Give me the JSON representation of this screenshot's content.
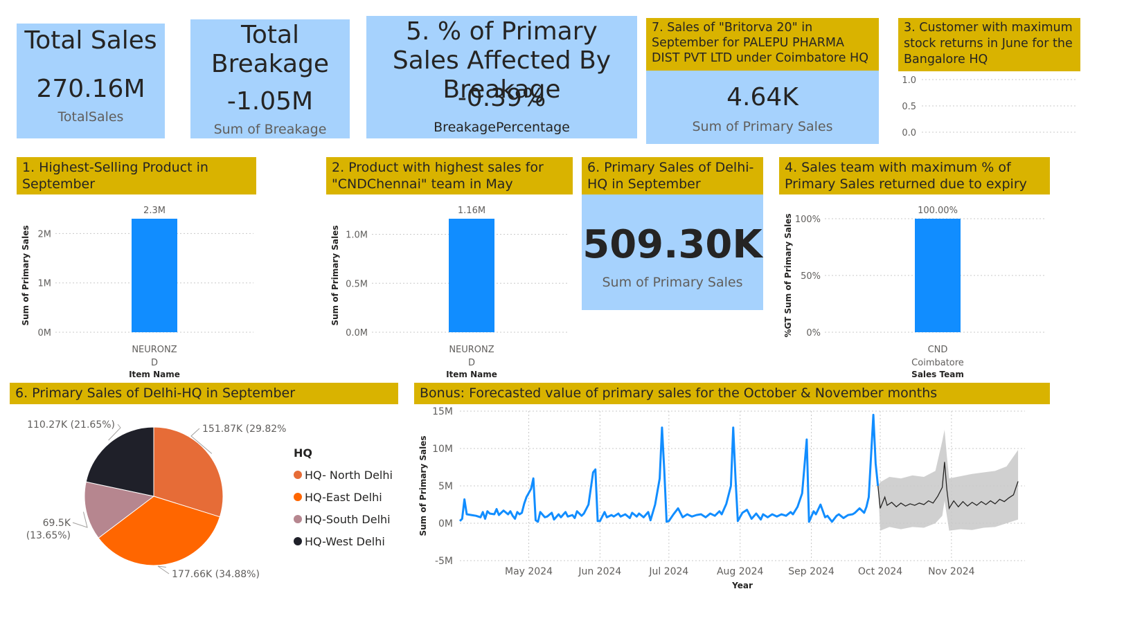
{
  "cards": {
    "total_sales": {
      "title": "Total Sales",
      "value": "270.16M",
      "label": "TotalSales"
    },
    "total_breakage": {
      "title": "Total Breakage",
      "value": "-1.05M",
      "label": "Sum of Breakage"
    },
    "breakage_pct": {
      "title": "5. % of Primary Sales Affected By Breakage",
      "value": "-0.39%",
      "label": "BreakagePercentage"
    },
    "britorva": {
      "title": "7. Sales of \"Britorva 20\" in September for PALEPU PHARMA DIST PVT LTD under Coimbatore HQ",
      "value": "4.64K",
      "label": "Sum of Primary Sales"
    },
    "delhi_sept": {
      "title": "6. Primary Sales of Delhi-HQ in September",
      "value": "509.30K",
      "label": "Sum of Primary Sales"
    }
  },
  "headers": {
    "customer_returns": "3. Customer with maximum stock returns in June for the Bangalore HQ",
    "highest_product": "1. Highest-Selling Product in September",
    "cnd_chennai": "2. Product with highest sales for \"CNDChennai\" team in May",
    "sales_team_expiry": "4. Sales team with maximum % of Primary Sales returned due to expiry",
    "delhi_pie": "6. Primary Sales of Delhi-HQ in September",
    "forecast": "Bonus: Forecasted value of primary sales for the October & November months"
  },
  "chart_data": [
    {
      "id": "customer_returns",
      "type": "bar",
      "categories": [],
      "values": [],
      "yticks": [
        "1.0",
        "0.5",
        "0.0"
      ],
      "ylim": [
        0,
        1
      ]
    },
    {
      "id": "highest_product",
      "type": "bar",
      "categories": [
        "NEURONZ D"
      ],
      "category_lines": [
        "NEURONZ",
        "D"
      ],
      "values": [
        2300000
      ],
      "data_labels": [
        "2.3M"
      ],
      "xlabel": "Item Name",
      "ylabel": "Sum of Primary Sales",
      "yticks": [
        "2M",
        "1M",
        "0M"
      ],
      "ylim": [
        0,
        2300000
      ],
      "color": "#118dff"
    },
    {
      "id": "cnd_chennai",
      "type": "bar",
      "categories": [
        "NEURONZ D"
      ],
      "category_lines": [
        "NEURONZ",
        "D"
      ],
      "values": [
        1160000
      ],
      "data_labels": [
        "1.16M"
      ],
      "xlabel": "Item Name",
      "ylabel": "Sum of Primary Sales",
      "yticks": [
        "1.0M",
        "0.5M",
        "0.0M"
      ],
      "ylim": [
        0,
        1160000
      ],
      "color": "#118dff"
    },
    {
      "id": "sales_team_expiry",
      "type": "bar",
      "categories": [
        "CND Coimbatore"
      ],
      "category_lines": [
        "CND",
        "Coimbatore"
      ],
      "values": [
        100
      ],
      "data_labels": [
        "100.00%"
      ],
      "xlabel": "Sales Team",
      "ylabel": "%GT Sum of Primary Sales",
      "yticks": [
        "100%",
        "50%",
        "0%"
      ],
      "ylim": [
        0,
        100
      ],
      "color": "#118dff"
    },
    {
      "id": "delhi_pie",
      "type": "pie",
      "legend_title": "HQ",
      "slices": [
        {
          "name": "HQ- North Delhi",
          "value": 151870,
          "label": "151.87K (29.82%)",
          "color": "#e66c37"
        },
        {
          "name": "HQ-East Delhi",
          "value": 177660,
          "label": "177.66K (34.88%)",
          "color": "#ff6600"
        },
        {
          "name": "HQ-South Delhi",
          "value": 69500,
          "label": "69.5K (13.65%)",
          "color": "#b6868f"
        },
        {
          "name": "HQ-West Delhi",
          "value": 110270,
          "label": "110.27K (21.65%)",
          "color": "#1f2029"
        }
      ]
    },
    {
      "id": "forecast",
      "type": "line",
      "xlabel": "Year",
      "ylabel": "Sum of Primary Sales",
      "x_start": "2024-04-01",
      "x_end": "2024-12-03",
      "x_ticks": [
        "May 2024",
        "Jun 2024",
        "Jul 2024",
        "Aug 2024",
        "Sep 2024",
        "Oct 2024",
        "Nov 2024"
      ],
      "x_tick_dates": [
        "2024-05-01",
        "2024-06-01",
        "2024-07-01",
        "2024-08-01",
        "2024-09-01",
        "2024-10-01",
        "2024-11-01"
      ],
      "yticks": [
        "15M",
        "10M",
        "5M",
        "0M",
        "-5M"
      ],
      "ylim": [
        -5,
        15
      ],
      "y_unit": "M",
      "actual": [
        [
          "2024-04-01",
          0.3
        ],
        [
          "2024-04-02",
          0.6
        ],
        [
          "2024-04-03",
          3.2
        ],
        [
          "2024-04-04",
          1.2
        ],
        [
          "2024-04-06",
          1.1
        ],
        [
          "2024-04-08",
          1.0
        ],
        [
          "2024-04-10",
          0.8
        ],
        [
          "2024-04-11",
          1.5
        ],
        [
          "2024-04-12",
          0.6
        ],
        [
          "2024-04-13",
          1.6
        ],
        [
          "2024-04-14",
          1.3
        ],
        [
          "2024-04-16",
          1.2
        ],
        [
          "2024-04-17",
          1.9
        ],
        [
          "2024-04-18",
          1.1
        ],
        [
          "2024-04-19",
          1.4
        ],
        [
          "2024-04-20",
          1.7
        ],
        [
          "2024-04-22",
          1.2
        ],
        [
          "2024-04-23",
          1.6
        ],
        [
          "2024-04-24",
          1.0
        ],
        [
          "2024-04-25",
          0.6
        ],
        [
          "2024-04-26",
          1.5
        ],
        [
          "2024-04-27",
          1.2
        ],
        [
          "2024-04-28",
          1.4
        ],
        [
          "2024-04-29",
          2.6
        ],
        [
          "2024-04-30",
          3.5
        ],
        [
          "2024-05-02",
          4.6
        ],
        [
          "2024-05-03",
          6.0
        ],
        [
          "2024-05-04",
          0.4
        ],
        [
          "2024-05-05",
          0.2
        ],
        [
          "2024-05-06",
          1.5
        ],
        [
          "2024-05-08",
          0.8
        ],
        [
          "2024-05-09",
          0.9
        ],
        [
          "2024-05-11",
          1.4
        ],
        [
          "2024-05-12",
          0.5
        ],
        [
          "2024-05-14",
          1.2
        ],
        [
          "2024-05-15",
          0.8
        ],
        [
          "2024-05-17",
          1.5
        ],
        [
          "2024-05-18",
          0.9
        ],
        [
          "2024-05-20",
          1.1
        ],
        [
          "2024-05-21",
          0.7
        ],
        [
          "2024-05-22",
          1.6
        ],
        [
          "2024-05-24",
          1.0
        ],
        [
          "2024-05-25",
          1.3
        ],
        [
          "2024-05-27",
          2.5
        ],
        [
          "2024-05-29",
          6.8
        ],
        [
          "2024-05-30",
          7.2
        ],
        [
          "2024-05-31",
          0.3
        ],
        [
          "2024-06-01",
          0.3
        ],
        [
          "2024-06-03",
          1.5
        ],
        [
          "2024-06-04",
          0.8
        ],
        [
          "2024-06-06",
          1.1
        ],
        [
          "2024-06-07",
          0.9
        ],
        [
          "2024-06-09",
          1.3
        ],
        [
          "2024-06-10",
          0.9
        ],
        [
          "2024-06-12",
          1.2
        ],
        [
          "2024-06-14",
          0.7
        ],
        [
          "2024-06-15",
          1.4
        ],
        [
          "2024-06-17",
          0.9
        ],
        [
          "2024-06-18",
          1.3
        ],
        [
          "2024-06-20",
          0.8
        ],
        [
          "2024-06-22",
          1.5
        ],
        [
          "2024-06-23",
          0.4
        ],
        [
          "2024-06-25",
          2.5
        ],
        [
          "2024-06-27",
          6.0
        ],
        [
          "2024-06-28",
          12.8
        ],
        [
          "2024-06-29",
          7.0
        ],
        [
          "2024-06-30",
          0.2
        ],
        [
          "2024-07-01",
          0.3
        ],
        [
          "2024-07-03",
          1.2
        ],
        [
          "2024-07-05",
          2.0
        ],
        [
          "2024-07-07",
          0.8
        ],
        [
          "2024-07-09",
          1.2
        ],
        [
          "2024-07-11",
          0.9
        ],
        [
          "2024-07-13",
          1.1
        ],
        [
          "2024-07-15",
          1.2
        ],
        [
          "2024-07-17",
          0.8
        ],
        [
          "2024-07-19",
          1.3
        ],
        [
          "2024-07-21",
          1.0
        ],
        [
          "2024-07-23",
          1.6
        ],
        [
          "2024-07-24",
          1.2
        ],
        [
          "2024-07-26",
          2.6
        ],
        [
          "2024-07-28",
          5.0
        ],
        [
          "2024-07-29",
          12.8
        ],
        [
          "2024-07-30",
          6.0
        ],
        [
          "2024-07-31",
          0.3
        ],
        [
          "2024-08-02",
          1.4
        ],
        [
          "2024-08-04",
          1.8
        ],
        [
          "2024-08-06",
          0.6
        ],
        [
          "2024-08-08",
          1.3
        ],
        [
          "2024-08-10",
          0.5
        ],
        [
          "2024-08-11",
          1.2
        ],
        [
          "2024-08-13",
          0.8
        ],
        [
          "2024-08-15",
          1.2
        ],
        [
          "2024-08-17",
          0.9
        ],
        [
          "2024-08-19",
          1.2
        ],
        [
          "2024-08-21",
          1.0
        ],
        [
          "2024-08-23",
          1.5
        ],
        [
          "2024-08-24",
          1.2
        ],
        [
          "2024-08-26",
          2.2
        ],
        [
          "2024-08-28",
          4.0
        ],
        [
          "2024-08-30",
          11.2
        ],
        [
          "2024-08-31",
          0.2
        ],
        [
          "2024-09-02",
          1.6
        ],
        [
          "2024-09-03",
          1.2
        ],
        [
          "2024-09-05",
          2.5
        ],
        [
          "2024-09-07",
          0.8
        ],
        [
          "2024-09-08",
          1.0
        ],
        [
          "2024-09-10",
          0.2
        ],
        [
          "2024-09-12",
          1.0
        ],
        [
          "2024-09-13",
          1.2
        ],
        [
          "2024-09-15",
          0.7
        ],
        [
          "2024-09-17",
          1.1
        ],
        [
          "2024-09-19",
          1.2
        ],
        [
          "2024-09-20",
          1.4
        ],
        [
          "2024-09-22",
          2.0
        ],
        [
          "2024-09-24",
          1.4
        ],
        [
          "2024-09-25",
          2.2
        ],
        [
          "2024-09-26",
          3.5
        ],
        [
          "2024-09-28",
          14.5
        ],
        [
          "2024-09-29",
          8.0
        ],
        [
          "2024-09-30",
          5.0
        ]
      ],
      "forecast": [
        [
          "2024-09-30",
          5.0
        ],
        [
          "2024-10-01",
          2.0
        ],
        [
          "2024-10-03",
          3.5
        ],
        [
          "2024-10-04",
          2.4
        ],
        [
          "2024-10-06",
          2.8
        ],
        [
          "2024-10-08",
          2.2
        ],
        [
          "2024-10-10",
          2.7
        ],
        [
          "2024-10-12",
          2.3
        ],
        [
          "2024-10-14",
          2.6
        ],
        [
          "2024-10-16",
          2.4
        ],
        [
          "2024-10-18",
          2.7
        ],
        [
          "2024-10-20",
          2.5
        ],
        [
          "2024-10-22",
          3.0
        ],
        [
          "2024-10-24",
          2.7
        ],
        [
          "2024-10-26",
          3.6
        ],
        [
          "2024-10-28",
          4.8
        ],
        [
          "2024-10-29",
          8.2
        ],
        [
          "2024-10-30",
          4.5
        ],
        [
          "2024-10-31",
          2.0
        ],
        [
          "2024-11-02",
          3.0
        ],
        [
          "2024-11-04",
          2.2
        ],
        [
          "2024-11-06",
          2.9
        ],
        [
          "2024-11-08",
          2.3
        ],
        [
          "2024-11-10",
          2.8
        ],
        [
          "2024-11-12",
          2.4
        ],
        [
          "2024-11-14",
          2.9
        ],
        [
          "2024-11-16",
          2.5
        ],
        [
          "2024-11-18",
          3.0
        ],
        [
          "2024-11-20",
          2.6
        ],
        [
          "2024-11-22",
          3.2
        ],
        [
          "2024-11-24",
          2.9
        ],
        [
          "2024-11-26",
          3.4
        ],
        [
          "2024-11-28",
          3.8
        ],
        [
          "2024-11-30",
          5.6
        ]
      ],
      "band": [
        [
          "2024-09-30",
          5.0,
          5.0
        ],
        [
          "2024-10-01",
          -1.0,
          5.5
        ],
        [
          "2024-10-05",
          -0.5,
          6.2
        ],
        [
          "2024-10-10",
          -0.8,
          6.0
        ],
        [
          "2024-10-15",
          -0.5,
          6.4
        ],
        [
          "2024-10-20",
          -0.6,
          6.2
        ],
        [
          "2024-10-25",
          0.0,
          7.0
        ],
        [
          "2024-10-28",
          1.0,
          11.0
        ],
        [
          "2024-10-29",
          3.0,
          12.5
        ],
        [
          "2024-10-30",
          1.0,
          9.0
        ],
        [
          "2024-10-31",
          -1.0,
          6.0
        ],
        [
          "2024-11-05",
          -0.8,
          6.3
        ],
        [
          "2024-11-10",
          -0.9,
          6.6
        ],
        [
          "2024-11-15",
          -0.6,
          6.8
        ],
        [
          "2024-11-20",
          -0.5,
          7.0
        ],
        [
          "2024-11-25",
          0.0,
          7.6
        ],
        [
          "2024-11-30",
          0.5,
          9.8
        ]
      ]
    }
  ]
}
